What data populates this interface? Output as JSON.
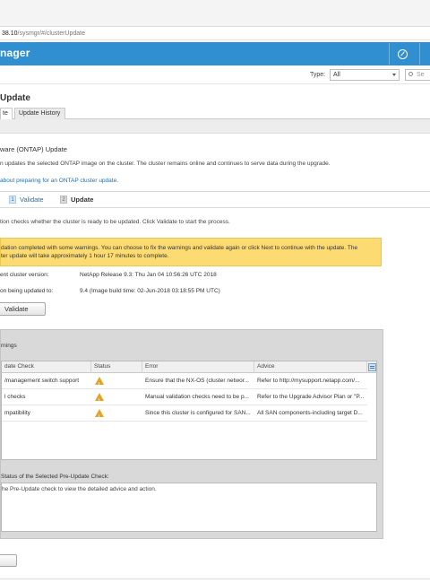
{
  "browser": {
    "url_host": "38.10",
    "url_path": "/sysmgr/#/clusterUpdate"
  },
  "header": {
    "title": "nager",
    "buttons": [
      "compass-icon"
    ]
  },
  "filter": {
    "type_label": "Type:",
    "type_value": "All",
    "search_placeholder": "Se"
  },
  "page": {
    "title": "Update",
    "tabs": [
      {
        "label": "te"
      },
      {
        "label": "Update History"
      }
    ]
  },
  "section": {
    "title": "ware (ONTAP) Update",
    "description": "n updates the selected ONTAP image on the cluster. The cluster remains online and continues to serve data during the upgrade.",
    "learn_link": "about preparing for an ONTAP cluster update."
  },
  "steps": {
    "validate": "Validate",
    "update": "Update"
  },
  "intro": "tion checks whether the cluster is ready to be updated. Click Validate to start the process.",
  "warning": {
    "line1": "dation completed with some warnings. You can choose to fix the warnings and validate again or click Next to continue with the update. The",
    "line2": "ter update will take approximately 1 hour 17 minutes to complete."
  },
  "info": {
    "current_label": "ent cluster version:",
    "current_value": "NetApp Release 9.3: Thu Jan 04 10:56:26 UTC 2018",
    "target_label": "on being updated to:",
    "target_value": "9.4 (Image build time: 02-Jun-2018 03:18:55 PM UTC)"
  },
  "validate_button": "Validate",
  "panel": {
    "title": "rnings",
    "columns": [
      "date Check",
      "Status",
      "Error",
      "Advice"
    ],
    "rows": [
      {
        "check": "/management switch support",
        "status": "warning-icon",
        "error": "Ensure that the NX-OS (cluster networ...",
        "advice": "Refer to http://mysupport.netapp.com/..."
      },
      {
        "check": "l checks",
        "status": "warning-icon",
        "error": "Manual validation checks need to be p...",
        "advice": "Refer to the Upgrade Advisor Plan or \"P..."
      },
      {
        "check": "mpatibility",
        "status": "warning-icon",
        "error": "Since this cluster is configured for SAN...",
        "advice": "All SAN components-including target D..."
      }
    ],
    "detail_label": "Status of the Selected Pre-Update Check:",
    "detail_text": "he Pre-Update check to view the detailed advice and action."
  },
  "bottom_button": ""
}
